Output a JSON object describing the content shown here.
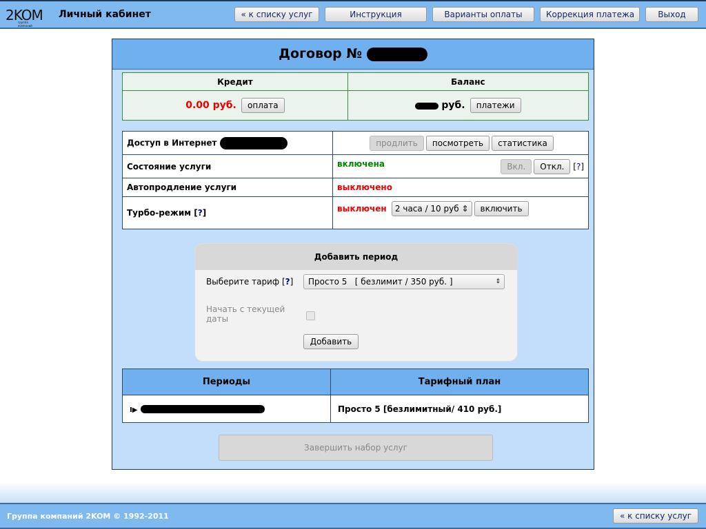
{
  "header": {
    "logo": "2KOM",
    "logo_sub": "группа компаний",
    "title": "Личный кабинет",
    "buttons": [
      "« к списку услуг",
      "Инструкция",
      "Варианты оплаты",
      "Коррекция платежа",
      "Выход"
    ]
  },
  "contract": {
    "title": "Договор №"
  },
  "finance": {
    "credit_label": "Кредит",
    "credit_value": "0.00 руб.",
    "pay_button": "оплата",
    "balance_label": "Баланс",
    "balance_currency": "руб.",
    "payments_button": "платежи"
  },
  "services": {
    "internet_label": "Доступ в Интернет",
    "extend": "продлить",
    "view": "посмотреть",
    "stats": "статистика",
    "state_label": "Состояние услуги",
    "state_value": "включена",
    "on": "Вкл.",
    "off": "Откл.",
    "help": "?",
    "autorenew_label": "Автопродление услуги",
    "autorenew_value": "выключено",
    "turbo_label": "Турбо-режим",
    "turbo_value": "выключен",
    "turbo_option": "2 часа / 10 руб",
    "turbo_enable": "включить"
  },
  "add_period": {
    "title": "Добавить период",
    "tariff_label": "Выберите тариф",
    "tariff_value": "Просто 5   [ безлимит / 350 руб. ]",
    "start_label": "Начать с текущей даты",
    "start_checked": false,
    "add_button": "Добавить"
  },
  "periods": {
    "headers": [
      "Периоды",
      "Тарифный план"
    ],
    "rows": [
      {
        "plan": "Просто 5 [безлимитный/ 410 руб.]"
      }
    ]
  },
  "finish_button": "Завершить набор услуг",
  "footer": {
    "copyright": "Группа компаний 2KOM © 1992-2011",
    "back": "« к списку услуг"
  }
}
